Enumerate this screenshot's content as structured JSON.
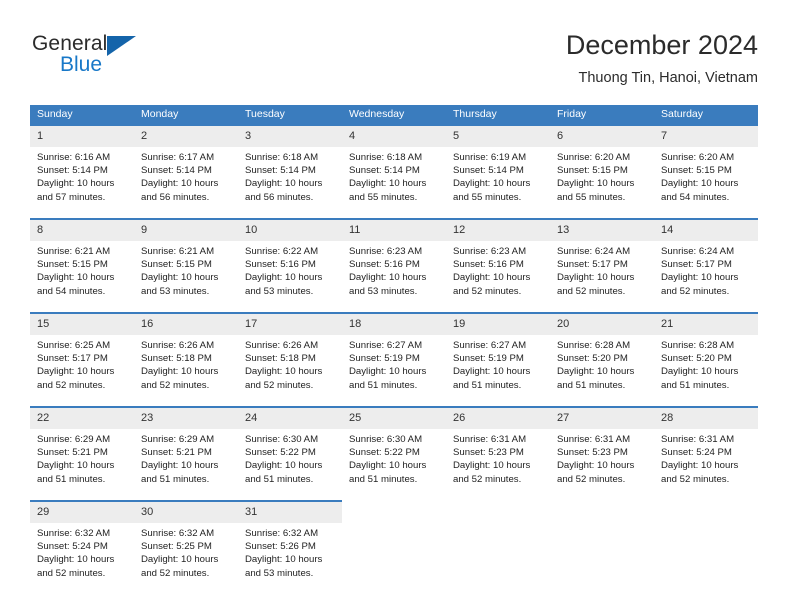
{
  "brand": {
    "name_top": "General",
    "name_bottom": "Blue",
    "triangle_color": "#1464aa",
    "blue_color": "#1878c8"
  },
  "header": {
    "title": "December 2024",
    "subtitle": "Thuong Tin, Hanoi, Vietnam"
  },
  "theme": {
    "header_bg": "#3a7cbe",
    "daynum_bg": "#ededed",
    "cell_bg": "#ffffff",
    "text": "#1f1f1f"
  },
  "weekdays": [
    "Sunday",
    "Monday",
    "Tuesday",
    "Wednesday",
    "Thursday",
    "Friday",
    "Saturday"
  ],
  "labels": {
    "sunrise_prefix": "Sunrise:",
    "sunset_prefix": "Sunset:",
    "daylight_prefix": "Daylight:"
  },
  "weeks": [
    [
      {
        "day": "1",
        "sunrise": "Sunrise: 6:16 AM",
        "sunset": "Sunset: 5:14 PM",
        "daylight1": "Daylight: 10 hours",
        "daylight2": "and 57 minutes."
      },
      {
        "day": "2",
        "sunrise": "Sunrise: 6:17 AM",
        "sunset": "Sunset: 5:14 PM",
        "daylight1": "Daylight: 10 hours",
        "daylight2": "and 56 minutes."
      },
      {
        "day": "3",
        "sunrise": "Sunrise: 6:18 AM",
        "sunset": "Sunset: 5:14 PM",
        "daylight1": "Daylight: 10 hours",
        "daylight2": "and 56 minutes."
      },
      {
        "day": "4",
        "sunrise": "Sunrise: 6:18 AM",
        "sunset": "Sunset: 5:14 PM",
        "daylight1": "Daylight: 10 hours",
        "daylight2": "and 55 minutes."
      },
      {
        "day": "5",
        "sunrise": "Sunrise: 6:19 AM",
        "sunset": "Sunset: 5:14 PM",
        "daylight1": "Daylight: 10 hours",
        "daylight2": "and 55 minutes."
      },
      {
        "day": "6",
        "sunrise": "Sunrise: 6:20 AM",
        "sunset": "Sunset: 5:15 PM",
        "daylight1": "Daylight: 10 hours",
        "daylight2": "and 55 minutes."
      },
      {
        "day": "7",
        "sunrise": "Sunrise: 6:20 AM",
        "sunset": "Sunset: 5:15 PM",
        "daylight1": "Daylight: 10 hours",
        "daylight2": "and 54 minutes."
      }
    ],
    [
      {
        "day": "8",
        "sunrise": "Sunrise: 6:21 AM",
        "sunset": "Sunset: 5:15 PM",
        "daylight1": "Daylight: 10 hours",
        "daylight2": "and 54 minutes."
      },
      {
        "day": "9",
        "sunrise": "Sunrise: 6:21 AM",
        "sunset": "Sunset: 5:15 PM",
        "daylight1": "Daylight: 10 hours",
        "daylight2": "and 53 minutes."
      },
      {
        "day": "10",
        "sunrise": "Sunrise: 6:22 AM",
        "sunset": "Sunset: 5:16 PM",
        "daylight1": "Daylight: 10 hours",
        "daylight2": "and 53 minutes."
      },
      {
        "day": "11",
        "sunrise": "Sunrise: 6:23 AM",
        "sunset": "Sunset: 5:16 PM",
        "daylight1": "Daylight: 10 hours",
        "daylight2": "and 53 minutes."
      },
      {
        "day": "12",
        "sunrise": "Sunrise: 6:23 AM",
        "sunset": "Sunset: 5:16 PM",
        "daylight1": "Daylight: 10 hours",
        "daylight2": "and 52 minutes."
      },
      {
        "day": "13",
        "sunrise": "Sunrise: 6:24 AM",
        "sunset": "Sunset: 5:17 PM",
        "daylight1": "Daylight: 10 hours",
        "daylight2": "and 52 minutes."
      },
      {
        "day": "14",
        "sunrise": "Sunrise: 6:24 AM",
        "sunset": "Sunset: 5:17 PM",
        "daylight1": "Daylight: 10 hours",
        "daylight2": "and 52 minutes."
      }
    ],
    [
      {
        "day": "15",
        "sunrise": "Sunrise: 6:25 AM",
        "sunset": "Sunset: 5:17 PM",
        "daylight1": "Daylight: 10 hours",
        "daylight2": "and 52 minutes."
      },
      {
        "day": "16",
        "sunrise": "Sunrise: 6:26 AM",
        "sunset": "Sunset: 5:18 PM",
        "daylight1": "Daylight: 10 hours",
        "daylight2": "and 52 minutes."
      },
      {
        "day": "17",
        "sunrise": "Sunrise: 6:26 AM",
        "sunset": "Sunset: 5:18 PM",
        "daylight1": "Daylight: 10 hours",
        "daylight2": "and 52 minutes."
      },
      {
        "day": "18",
        "sunrise": "Sunrise: 6:27 AM",
        "sunset": "Sunset: 5:19 PM",
        "daylight1": "Daylight: 10 hours",
        "daylight2": "and 51 minutes."
      },
      {
        "day": "19",
        "sunrise": "Sunrise: 6:27 AM",
        "sunset": "Sunset: 5:19 PM",
        "daylight1": "Daylight: 10 hours",
        "daylight2": "and 51 minutes."
      },
      {
        "day": "20",
        "sunrise": "Sunrise: 6:28 AM",
        "sunset": "Sunset: 5:20 PM",
        "daylight1": "Daylight: 10 hours",
        "daylight2": "and 51 minutes."
      },
      {
        "day": "21",
        "sunrise": "Sunrise: 6:28 AM",
        "sunset": "Sunset: 5:20 PM",
        "daylight1": "Daylight: 10 hours",
        "daylight2": "and 51 minutes."
      }
    ],
    [
      {
        "day": "22",
        "sunrise": "Sunrise: 6:29 AM",
        "sunset": "Sunset: 5:21 PM",
        "daylight1": "Daylight: 10 hours",
        "daylight2": "and 51 minutes."
      },
      {
        "day": "23",
        "sunrise": "Sunrise: 6:29 AM",
        "sunset": "Sunset: 5:21 PM",
        "daylight1": "Daylight: 10 hours",
        "daylight2": "and 51 minutes."
      },
      {
        "day": "24",
        "sunrise": "Sunrise: 6:30 AM",
        "sunset": "Sunset: 5:22 PM",
        "daylight1": "Daylight: 10 hours",
        "daylight2": "and 51 minutes."
      },
      {
        "day": "25",
        "sunrise": "Sunrise: 6:30 AM",
        "sunset": "Sunset: 5:22 PM",
        "daylight1": "Daylight: 10 hours",
        "daylight2": "and 51 minutes."
      },
      {
        "day": "26",
        "sunrise": "Sunrise: 6:31 AM",
        "sunset": "Sunset: 5:23 PM",
        "daylight1": "Daylight: 10 hours",
        "daylight2": "and 52 minutes."
      },
      {
        "day": "27",
        "sunrise": "Sunrise: 6:31 AM",
        "sunset": "Sunset: 5:23 PM",
        "daylight1": "Daylight: 10 hours",
        "daylight2": "and 52 minutes."
      },
      {
        "day": "28",
        "sunrise": "Sunrise: 6:31 AM",
        "sunset": "Sunset: 5:24 PM",
        "daylight1": "Daylight: 10 hours",
        "daylight2": "and 52 minutes."
      }
    ],
    [
      {
        "day": "29",
        "sunrise": "Sunrise: 6:32 AM",
        "sunset": "Sunset: 5:24 PM",
        "daylight1": "Daylight: 10 hours",
        "daylight2": "and 52 minutes."
      },
      {
        "day": "30",
        "sunrise": "Sunrise: 6:32 AM",
        "sunset": "Sunset: 5:25 PM",
        "daylight1": "Daylight: 10 hours",
        "daylight2": "and 52 minutes."
      },
      {
        "day": "31",
        "sunrise": "Sunrise: 6:32 AM",
        "sunset": "Sunset: 5:26 PM",
        "daylight1": "Daylight: 10 hours",
        "daylight2": "and 53 minutes."
      },
      null,
      null,
      null,
      null
    ]
  ]
}
